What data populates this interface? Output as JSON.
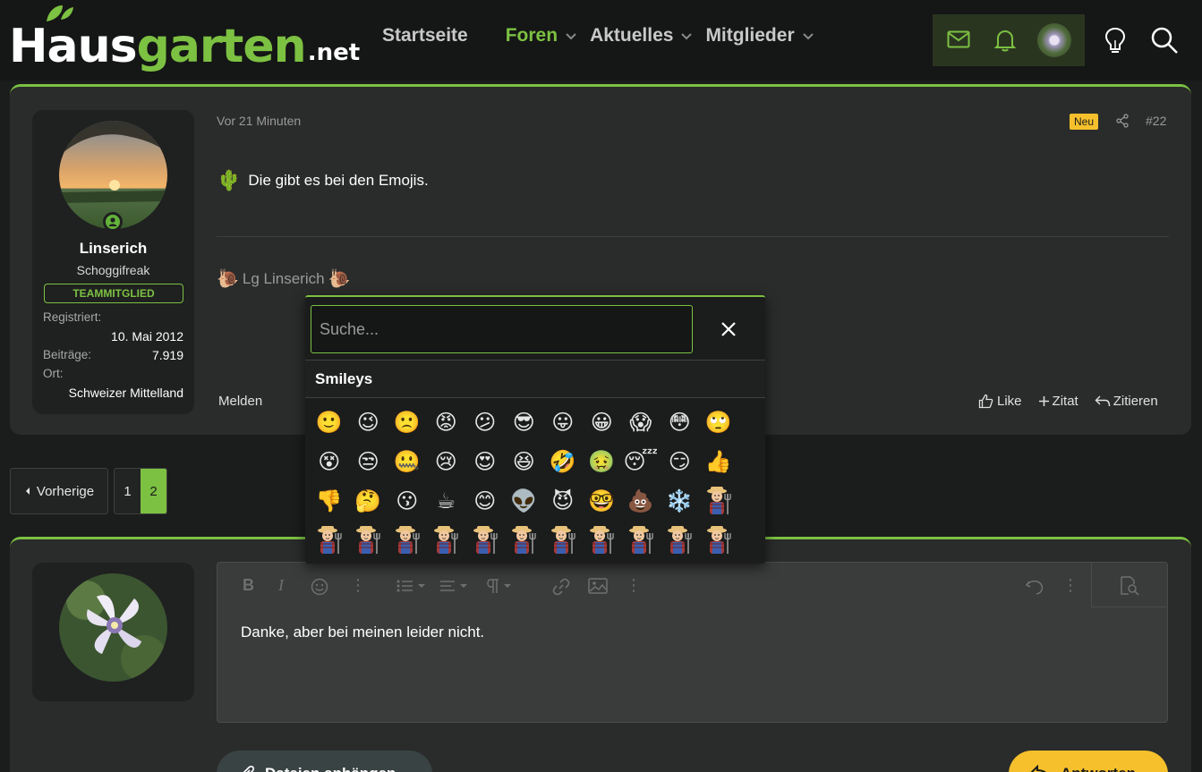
{
  "header": {
    "logo": {
      "part1": "Haus",
      "part2": "garten",
      "part3": ".net"
    },
    "nav": [
      {
        "label": "Startseite",
        "active": false,
        "dropdown": false
      },
      {
        "label": "Foren",
        "active": true,
        "dropdown": true
      },
      {
        "label": "Aktuelles",
        "active": false,
        "dropdown": true
      },
      {
        "label": "Mitglieder",
        "active": false,
        "dropdown": true
      }
    ],
    "icons": [
      "mail-icon",
      "bell-icon",
      "avatar",
      "lightbulb-icon",
      "search-icon"
    ]
  },
  "post": {
    "user": {
      "name": "Linserich",
      "title": "Schoggifreak",
      "badge": "TEAMMITGLIED",
      "registered_label": "Registriert:",
      "registered_value": "10. Mai 2012",
      "posts_label": "Beiträge:",
      "posts_value": "7.919",
      "location_label": "Ort:",
      "location_value": "Schweizer Mittelland"
    },
    "time": "Vor 21 Minuten",
    "new_badge": "Neu",
    "number": "#22",
    "body_emoji": "🌵",
    "body": "Die gibt es bei den Emojis.",
    "signature": "Lg Linserich",
    "signature_emoji": "🐌",
    "report": "Melden",
    "actions": {
      "like": "Like",
      "quote": "Zitat",
      "reply_quote": "Zitieren"
    }
  },
  "pagination": {
    "prev": "Vorherige",
    "pages": [
      "1",
      "2"
    ],
    "current": "2"
  },
  "reply": {
    "editor_text": "Danke, aber bei meinen leider nicht.",
    "attach": "Dateien anhängen",
    "submit": "Antworten"
  },
  "emoji_popup": {
    "search_placeholder": "Suche...",
    "category": "Smileys",
    "rows": [
      [
        "🙂",
        "😉",
        "🙁",
        "😡",
        "😕",
        "😎",
        "😛",
        "😀",
        "😱",
        "😳",
        "🙄"
      ],
      [
        "😵",
        "😒",
        "🤐",
        "😢",
        "😍",
        "😆",
        "🤣",
        "🤢",
        "😴",
        "😏",
        "👍"
      ],
      [
        "👎",
        "🤔",
        "😗",
        "☕",
        "😊",
        "👽",
        "😈",
        "🤓",
        "💩",
        "❄️",
        "farmer"
      ],
      [
        "farmer",
        "farmer",
        "farmer",
        "farmer",
        "farmer",
        "farmer",
        "farmer",
        "farmer",
        "farmer",
        "farmer",
        "farmer"
      ]
    ]
  },
  "colors": {
    "accent": "#7cc142",
    "yellow": "#f5c02b",
    "background": "#1b1c1c",
    "card": "#2a2b2b"
  }
}
